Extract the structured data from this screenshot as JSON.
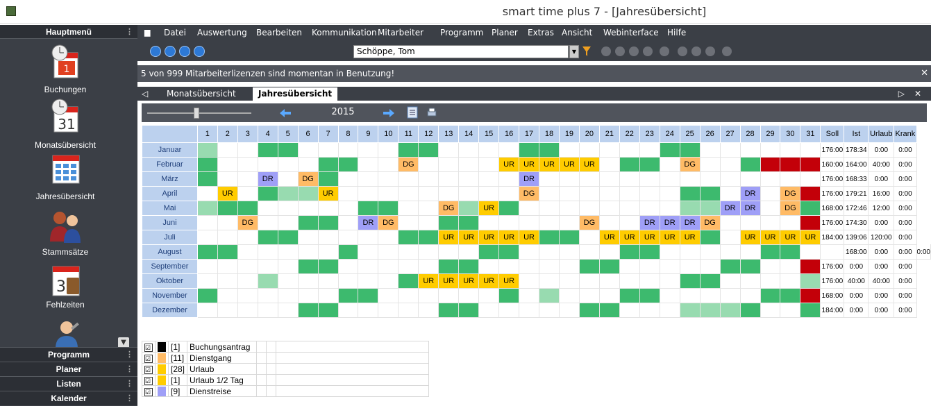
{
  "window": {
    "title": "smart time plus 7 - [Jahresübersicht]"
  },
  "sidebar": {
    "header": "Hauptmenü",
    "items": [
      {
        "label": "Buchungen",
        "icon": "clock-calendar-icon"
      },
      {
        "label": "Monatsübersicht",
        "icon": "clock-calendar-31-icon"
      },
      {
        "label": "Jahresübersicht",
        "icon": "year-calendar-icon"
      },
      {
        "label": "Stammsätze",
        "icon": "people-icon"
      },
      {
        "label": "Fehlzeiten",
        "icon": "absence-calendar-icon"
      }
    ],
    "sections": [
      "Programm",
      "Planer",
      "Listen",
      "Kalender"
    ]
  },
  "menubar": [
    "Datei",
    "Auswertung",
    "Bearbeiten",
    "Kommunikation",
    "Mitarbeiter",
    "Programm",
    "Planer",
    "Extras",
    "Ansicht",
    "Webinterface",
    "Hilfe"
  ],
  "toolbar": {
    "employee": "Schöppe, Tom"
  },
  "notice": "5 von 999 Mitarbeiterlizenzen sind momentan in Benutzung!",
  "tabs": [
    {
      "label": "Monatsübersicht",
      "active": false
    },
    {
      "label": "Jahresübersicht",
      "active": true
    }
  ],
  "year": "2015",
  "colors": {
    "green": "#3dba6e",
    "lightgreen": "#98dbb0",
    "urlaub": "#ffcc00",
    "dienstgang": "#ffbb66",
    "dienstreise": "#9f9ff7",
    "red": "#c30009",
    "header": "#bcd1ee"
  },
  "grid": {
    "stat_headers": [
      "Soll",
      "Ist",
      "Urlaub",
      "Krank"
    ],
    "months": [
      {
        "name": "Januar",
        "days": [
          "L",
          "",
          "",
          "G",
          "G",
          "",
          "",
          "",
          "",
          "",
          "G",
          "G",
          "",
          "",
          "",
          "",
          "G",
          "G",
          "",
          "",
          "",
          "",
          "",
          "G",
          "G",
          "",
          "",
          "",
          "",
          "",
          ""
        ],
        "soll": "176:00",
        "ist": "178:34",
        "urlaub": "0:00",
        "krank": "0:00"
      },
      {
        "name": "Februar",
        "days": [
          "G",
          "",
          "",
          "",
          "",
          "",
          "G",
          "G",
          "",
          "",
          "DG",
          "",
          "",
          "",
          "",
          "UR",
          "UR",
          "UR",
          "UR",
          "UR",
          "",
          "G",
          "G",
          "",
          "DG",
          "",
          "",
          "G",
          "R",
          "R",
          "R"
        ],
        "soll": "160:00",
        "ist": "164:00",
        "urlaub": "40:00",
        "krank": "0:00"
      },
      {
        "name": "März",
        "days": [
          "G",
          "",
          "",
          "DR",
          "",
          "DG",
          "G",
          "",
          "",
          "",
          "",
          "",
          "",
          "",
          "",
          "",
          "DR",
          "",
          "",
          "",
          "",
          "",
          "",
          "",
          "",
          "",
          "",
          "",
          "",
          "",
          ""
        ],
        "soll": "176:00",
        "ist": "168:33",
        "urlaub": "0:00",
        "krank": "0:00"
      },
      {
        "name": "April",
        "days": [
          "",
          "UR",
          "",
          "G",
          "L",
          "L",
          "UR",
          "",
          "",
          "",
          "",
          "",
          "",
          "",
          "",
          "",
          "DG",
          "",
          "",
          "",
          "",
          "",
          "",
          "",
          "G",
          "G",
          "",
          "DR",
          "",
          "DG",
          "R"
        ],
        "soll": "176:00",
        "ist": "179:21",
        "urlaub": "16:00",
        "krank": "0:00"
      },
      {
        "name": "Mai",
        "days": [
          "L",
          "G",
          "G",
          "",
          "",
          "",
          "",
          "",
          "G",
          "G",
          "",
          "",
          "DG",
          "L",
          "UR",
          "G",
          "",
          "",
          "",
          "",
          "",
          "",
          "",
          "",
          "L",
          "L",
          "DR",
          "DR",
          "",
          "DG",
          "G"
        ],
        "soll": "168:00",
        "ist": "172:46",
        "urlaub": "12:00",
        "krank": "0:00"
      },
      {
        "name": "Juni",
        "days": [
          "",
          "",
          "DG",
          "",
          "",
          "G",
          "G",
          "",
          "DR",
          "DG",
          "",
          "",
          "G",
          "G",
          "",
          "",
          "",
          "",
          "",
          "DG",
          "",
          "",
          "DR",
          "DR",
          "DR",
          "DG",
          "",
          "",
          "",
          "",
          "R"
        ],
        "soll": "176:00",
        "ist": "174:30",
        "urlaub": "0:00",
        "krank": "0:00"
      },
      {
        "name": "Juli",
        "days": [
          "",
          "",
          "",
          "G",
          "G",
          "",
          "",
          "",
          "",
          "",
          "G",
          "G",
          "UR",
          "UR",
          "UR",
          "UR",
          "UR",
          "G",
          "G",
          "",
          "UR",
          "UR",
          "UR",
          "UR",
          "UR",
          "G",
          "",
          "UR",
          "UR",
          "UR",
          "UR"
        ],
        "soll": "184:00",
        "ist": "139:06",
        "urlaub": "120:00",
        "krank": "0:00"
      },
      {
        "name": "August",
        "days": [
          "G",
          "G",
          "",
          "",
          "",
          "",
          "",
          "G",
          "",
          "",
          "",
          "",
          "",
          "",
          "G",
          "G",
          "",
          "",
          "",
          "",
          "",
          "G",
          "G",
          "",
          "",
          "",
          "",
          "",
          "G",
          "G",
          "",
          ""
        ],
        "soll": "168:00",
        "ist": "0:00",
        "urlaub": "0:00",
        "krank": "0:00"
      },
      {
        "name": "September",
        "days": [
          "",
          "",
          "",
          "",
          "",
          "G",
          "G",
          "",
          "",
          "",
          "",
          "",
          "G",
          "G",
          "",
          "",
          "",
          "",
          "",
          "G",
          "G",
          "",
          "",
          "",
          "",
          "",
          "G",
          "G",
          "",
          "",
          "R"
        ],
        "soll": "176:00",
        "ist": "0:00",
        "urlaub": "0:00",
        "krank": "0:00"
      },
      {
        "name": "Oktober",
        "days": [
          "",
          "",
          "",
          "L",
          "",
          "",
          "",
          "",
          "",
          "",
          "G",
          "UR",
          "UR",
          "UR",
          "UR",
          "UR",
          "",
          "",
          "",
          "",
          "",
          "",
          "",
          "",
          "G",
          "G",
          "",
          "",
          "",
          "",
          "L"
        ],
        "soll": "176:00",
        "ist": "40:00",
        "urlaub": "40:00",
        "krank": "0:00"
      },
      {
        "name": "November",
        "days": [
          "G",
          "",
          "",
          "",
          "",
          "",
          "",
          "G",
          "G",
          "",
          "",
          "",
          "",
          "",
          "",
          "G",
          "",
          "L",
          "",
          "",
          "",
          "G",
          "G",
          "",
          "",
          "",
          "",
          "",
          "G",
          "G",
          "R"
        ],
        "soll": "168:00",
        "ist": "0:00",
        "urlaub": "0:00",
        "krank": "0:00"
      },
      {
        "name": "Dezember",
        "days": [
          "",
          "",
          "",
          "",
          "",
          "G",
          "G",
          "",
          "",
          "",
          "",
          "",
          "G",
          "G",
          "",
          "",
          "",
          "",
          "",
          "G",
          "G",
          "",
          "",
          "",
          "L",
          "L",
          "L",
          "G",
          "",
          "",
          "G"
        ],
        "soll": "184:00",
        "ist": "0:00",
        "urlaub": "0:00",
        "krank": "0:00"
      }
    ]
  },
  "legend": [
    {
      "count": "[1]",
      "label": "Buchungsantrag",
      "color": "#000000"
    },
    {
      "count": "[11]",
      "label": "Dienstgang",
      "color": "#ffbb66"
    },
    {
      "count": "[28]",
      "label": "Urlaub",
      "color": "#ffcc00"
    },
    {
      "count": "[1]",
      "label": "Urlaub 1/2 Tag",
      "color": "#ffcc00"
    },
    {
      "count": "[9]",
      "label": "Dienstreise",
      "color": "#9f9ff7"
    }
  ]
}
